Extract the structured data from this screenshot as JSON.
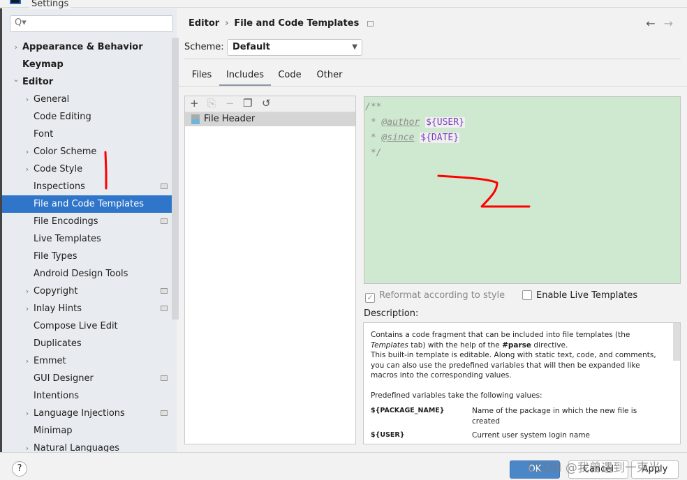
{
  "window": {
    "title": "Settings"
  },
  "search": {
    "placeholder": "Q▾"
  },
  "tree": [
    {
      "label": "Appearance & Behavior",
      "level": 0,
      "chevron": "right",
      "bold": true
    },
    {
      "label": "Keymap",
      "level": 0,
      "bold": true
    },
    {
      "label": "Editor",
      "level": 0,
      "chevron": "down",
      "bold": true
    },
    {
      "label": "General",
      "level": 1,
      "chevron": "right"
    },
    {
      "label": "Code Editing",
      "level": 1
    },
    {
      "label": "Font",
      "level": 1
    },
    {
      "label": "Color Scheme",
      "level": 1,
      "chevron": "right"
    },
    {
      "label": "Code Style",
      "level": 1,
      "chevron": "right"
    },
    {
      "label": "Inspections",
      "level": 1,
      "badge": true
    },
    {
      "label": "File and Code Templates",
      "level": 1,
      "selected": true
    },
    {
      "label": "File Encodings",
      "level": 1,
      "badge": true
    },
    {
      "label": "Live Templates",
      "level": 1
    },
    {
      "label": "File Types",
      "level": 1
    },
    {
      "label": "Android Design Tools",
      "level": 1
    },
    {
      "label": "Copyright",
      "level": 1,
      "chevron": "right",
      "badge": true
    },
    {
      "label": "Inlay Hints",
      "level": 1,
      "chevron": "right",
      "badge": true
    },
    {
      "label": "Compose Live Edit",
      "level": 1
    },
    {
      "label": "Duplicates",
      "level": 1
    },
    {
      "label": "Emmet",
      "level": 1,
      "chevron": "right"
    },
    {
      "label": "GUI Designer",
      "level": 1,
      "badge": true
    },
    {
      "label": "Intentions",
      "level": 1
    },
    {
      "label": "Language Injections",
      "level": 1,
      "chevron": "right",
      "badge": true
    },
    {
      "label": "Minimap",
      "level": 1
    },
    {
      "label": "Natural Languages",
      "level": 1,
      "chevron": "right"
    }
  ],
  "breadcrumb": {
    "parent": "Editor",
    "sep": "›",
    "current": "File and Code Templates"
  },
  "nav": {
    "back": "←",
    "forward": "→"
  },
  "scheme": {
    "label": "Scheme:",
    "value": "Default",
    "arrow": "▼"
  },
  "tabs": [
    {
      "label": "Files"
    },
    {
      "label": "Includes",
      "active": true
    },
    {
      "label": "Code"
    },
    {
      "label": "Other"
    }
  ],
  "list_toolbar": {
    "add": "+",
    "copy_add": "⎘",
    "remove": "−",
    "copy": "❐",
    "reset": "↺"
  },
  "templates": [
    {
      "label": "File Header",
      "selected": true
    }
  ],
  "editor": {
    "line1": "/**",
    "line2_prefix": " * ",
    "author_tag": "@author",
    "user_var": "${USER}",
    "line3_prefix": " * ",
    "since_tag": "@since",
    "date_var": "${DATE}",
    "line4": " */"
  },
  "options": {
    "reformat": "Reformat according to style",
    "reformat_checked": true,
    "live_templates": "Enable Live Templates",
    "live_checked": false
  },
  "description": {
    "label": "Description:",
    "p1_a": "Contains a code fragment that can be included into file templates (the ",
    "p1_em": "Templates",
    "p1_b": " tab) with the help of the ",
    "p1_strong": "#parse",
    "p1_c": " directive.",
    "p1_d": "This built-in template is editable. Along with static text, code, and comments, you can also use the predefined variables that will then be expanded like macros into the corresponding values.",
    "p2": "Predefined variables take the following values:",
    "vars": [
      {
        "name": "${PACKAGE_NAME}",
        "desc": "Name of the package in which the new file is created"
      },
      {
        "name": "${USER}",
        "desc": "Current user system login name"
      }
    ]
  },
  "buttons": {
    "help": "?",
    "ok": "OK",
    "cancel": "Cancel",
    "apply": "Apply"
  },
  "watermark": "CSDN @我曾遇到一束光",
  "annotations": {
    "color": "#ff0000",
    "marks": [
      "1",
      "2"
    ]
  }
}
